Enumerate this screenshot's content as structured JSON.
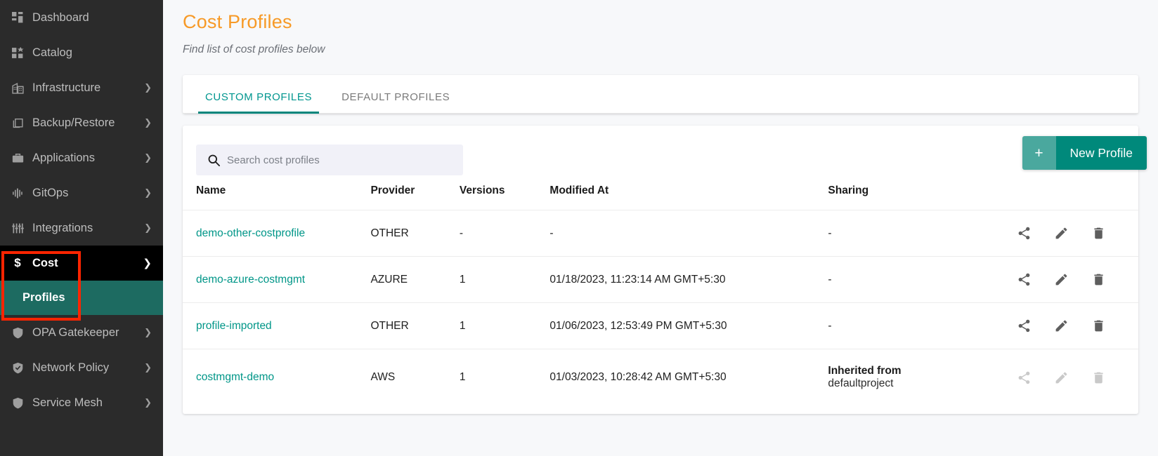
{
  "colors": {
    "accent_teal": "#009688",
    "title_orange": "#f79a27",
    "sidebar_bg": "#2b2b2b",
    "active_sub_bg": "#1d6b61",
    "annotation_red": "#ff2400",
    "button_teal": "#00897b",
    "button_plus_teal": "#4aa89e",
    "search_bg": "#f1f1f8"
  },
  "sidebar": {
    "items": [
      {
        "label": "Dashboard",
        "icon": "dashboard-icon",
        "expandable": false
      },
      {
        "label": "Catalog",
        "icon": "catalog-icon",
        "expandable": false
      },
      {
        "label": "Infrastructure",
        "icon": "building-icon",
        "expandable": true
      },
      {
        "label": "Backup/Restore",
        "icon": "copy-icon",
        "expandable": true
      },
      {
        "label": "Applications",
        "icon": "briefcase-icon",
        "expandable": true
      },
      {
        "label": "GitOps",
        "icon": "pipeline-icon",
        "expandable": true
      },
      {
        "label": "Integrations",
        "icon": "sliders-icon",
        "expandable": true
      }
    ],
    "cost": {
      "label": "Cost",
      "icon": "dollar-icon",
      "chevron": "chevron-down-icon",
      "expanded": true,
      "children": [
        {
          "label": "Profiles",
          "active": true
        }
      ]
    },
    "items_after": [
      {
        "label": "OPA Gatekeeper",
        "icon": "shield-icon",
        "expandable": true
      },
      {
        "label": "Network Policy",
        "icon": "shield-check-icon",
        "expandable": true
      },
      {
        "label": "Service Mesh",
        "icon": "shield-icon",
        "expandable": true
      }
    ]
  },
  "header": {
    "title": "Cost Profiles",
    "subtitle": "Find list of cost profiles below"
  },
  "tabs": [
    {
      "label": "CUSTOM PROFILES",
      "active": true
    },
    {
      "label": "DEFAULT PROFILES",
      "active": false
    }
  ],
  "toolbar": {
    "search_placeholder": "Search cost profiles",
    "search_value": "",
    "search_icon": "search-icon",
    "new_profile_label": "New Profile",
    "new_profile_plus": "+"
  },
  "table": {
    "columns": [
      "Name",
      "Provider",
      "Versions",
      "Modified At",
      "Sharing"
    ],
    "rows": [
      {
        "name": "demo-other-costprofile",
        "provider": "OTHER",
        "versions": "-",
        "modified_at": "-",
        "sharing": "-",
        "sharing_sub": "",
        "actions_enabled": true
      },
      {
        "name": "demo-azure-costmgmt",
        "provider": "AZURE",
        "versions": "1",
        "modified_at": "01/18/2023, 11:23:14 AM GMT+5:30",
        "sharing": "-",
        "sharing_sub": "",
        "actions_enabled": true
      },
      {
        "name": "profile-imported",
        "provider": "OTHER",
        "versions": "1",
        "modified_at": "01/06/2023, 12:53:49 PM GMT+5:30",
        "sharing": "-",
        "sharing_sub": "",
        "actions_enabled": true
      },
      {
        "name": "costmgmt-demo",
        "provider": "AWS",
        "versions": "1",
        "modified_at": "01/03/2023, 10:28:42 AM GMT+5:30",
        "sharing": "Inherited from",
        "sharing_sub": "defaultproject",
        "actions_enabled": false
      }
    ],
    "action_icons": [
      "share-icon",
      "edit-pencil-icon",
      "delete-trash-icon"
    ]
  }
}
